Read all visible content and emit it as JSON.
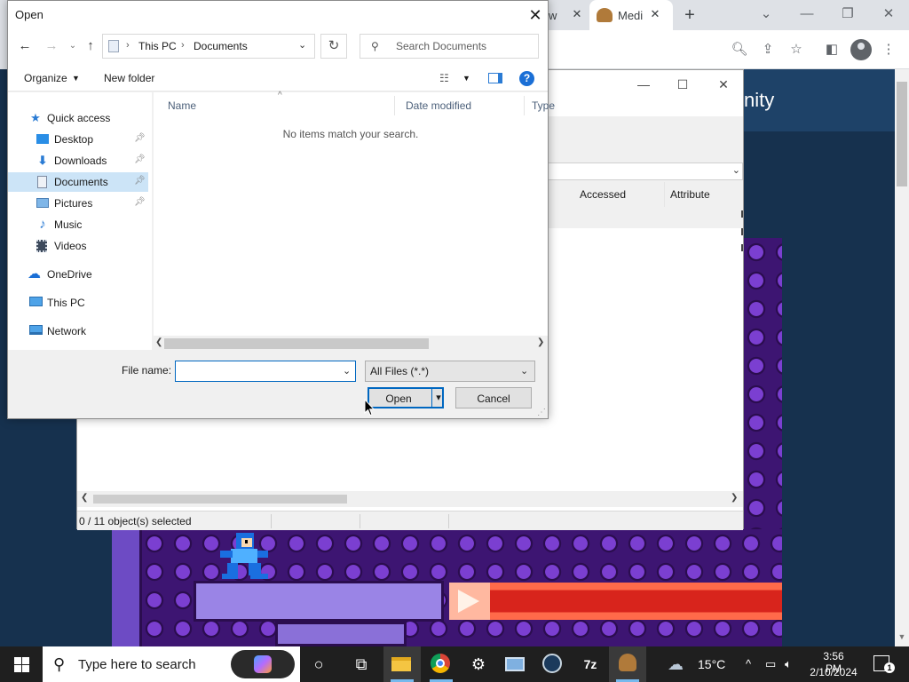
{
  "browser": {
    "tabs": [
      {
        "label": "w",
        "close": "✕"
      },
      {
        "label": "Medi",
        "close": "✕"
      }
    ],
    "new_tab": "+",
    "page_heading": "nity",
    "window_controls": [
      "⌄",
      "—",
      "❐",
      "✕"
    ]
  },
  "file_manager": {
    "columns": [
      "Accessed",
      "Attribute"
    ],
    "status": "0 / 11 object(s) selected",
    "window_controls": [
      "—",
      "☐",
      "✕"
    ]
  },
  "dialog": {
    "title": "Open",
    "address": {
      "segments": [
        "This PC",
        "Documents"
      ]
    },
    "search_placeholder": "Search Documents",
    "commands": {
      "organize": "Organize",
      "new_folder": "New folder",
      "help": "?"
    },
    "nav": [
      {
        "label": "Quick access",
        "icon": "star-icon"
      },
      {
        "label": "Desktop",
        "icon": "desktop-icon",
        "pinned": true
      },
      {
        "label": "Downloads",
        "icon": "download-icon",
        "pinned": true
      },
      {
        "label": "Documents",
        "icon": "document-icon",
        "pinned": true,
        "selected": true
      },
      {
        "label": "Pictures",
        "icon": "pictures-icon",
        "pinned": true
      },
      {
        "label": "Music",
        "icon": "music-icon"
      },
      {
        "label": "Videos",
        "icon": "video-icon"
      },
      {
        "label": "OneDrive",
        "icon": "cloud-icon"
      },
      {
        "label": "This PC",
        "icon": "computer-icon"
      },
      {
        "label": "Network",
        "icon": "network-icon"
      }
    ],
    "columns": [
      "Name",
      "Date modified",
      "Type"
    ],
    "empty_message": "No items match your search.",
    "file_name_label": "File name:",
    "file_name_value": "",
    "file_type": "All Files (*.*)",
    "open_label": "Open",
    "cancel_label": "Cancel"
  },
  "taskbar": {
    "search_text": "Type here to search",
    "weather_temp": "15°C",
    "time": "3:56 PM",
    "date": "2/10/2024",
    "notification_count": "1",
    "apps": [
      "cortana-icon",
      "task-view-icon",
      "file-explorer-icon",
      "chrome-icon",
      "settings-icon",
      "remote-desktop-icon",
      "steam-icon",
      "7zip-icon",
      "game-icon"
    ]
  },
  "colors": {
    "accent": "#0067c0",
    "selection": "#cce4f7",
    "taskbar": "#1f1f1f"
  }
}
